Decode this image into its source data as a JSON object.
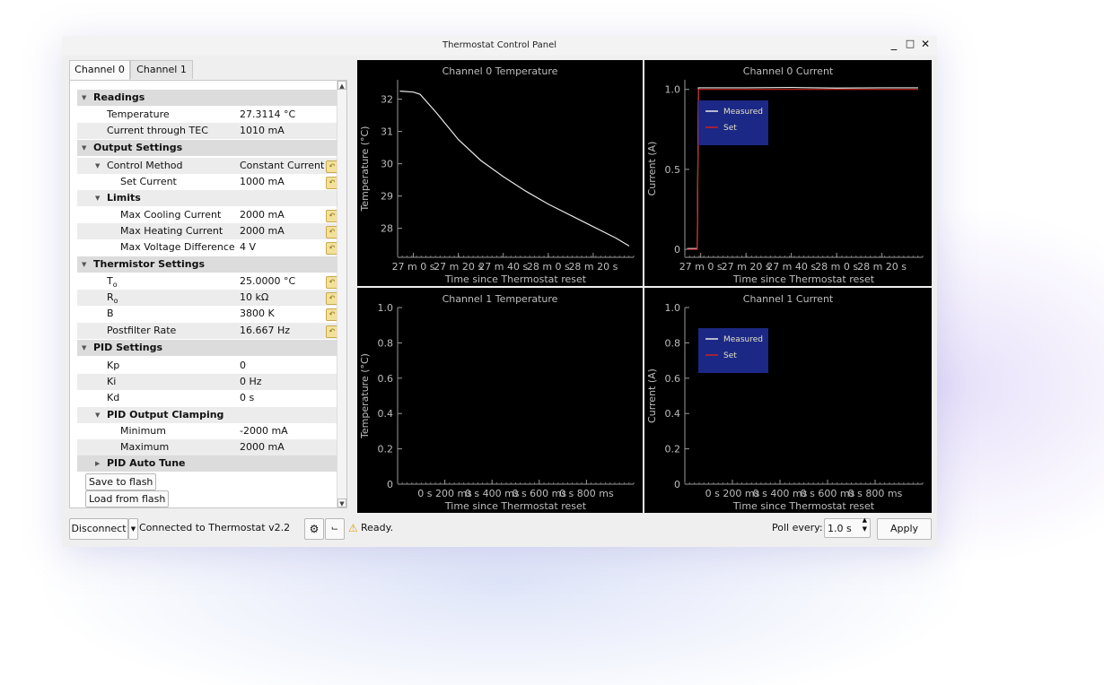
{
  "window": {
    "title": "Thermostat Control Panel",
    "minimize": "_",
    "maximize": "□",
    "close": "✕"
  },
  "tabs": [
    "Channel 0",
    "Channel 1"
  ],
  "tree": {
    "readings": "Readings",
    "temperature_label": "Temperature",
    "temperature_value": "27.3114 °C",
    "current_label": "Current through TEC",
    "current_value": "1010 mA",
    "output_settings": "Output Settings",
    "control_method_label": "Control Method",
    "control_method_value": "Constant Current",
    "set_current_label": "Set Current",
    "set_current_value": "1000 mA",
    "limits": "Limits",
    "max_cooling_label": "Max Cooling Current",
    "max_cooling_value": "2000 mA",
    "max_heating_label": "Max Heating Current",
    "max_heating_value": "2000 mA",
    "max_voltage_label": "Max Voltage Difference",
    "max_voltage_value": "4 V",
    "thermistor_settings": "Thermistor Settings",
    "t0_label": "T",
    "t0_sub": "o",
    "t0_value": "25.0000 °C",
    "r0_label": "R",
    "r0_sub": "o",
    "r0_value": "10 kΩ",
    "b_label": "B",
    "b_value": "3800 K",
    "postfilter_label": "Postfilter Rate",
    "postfilter_value": "16.667 Hz",
    "pid_settings": "PID Settings",
    "kp_label": "Kp",
    "kp_value": "0",
    "ki_label": "Ki",
    "ki_value": "0 Hz",
    "kd_label": "Kd",
    "kd_value": "0 s",
    "pid_clamp": "PID Output Clamping",
    "min_label": "Minimum",
    "min_value": "-2000 mA",
    "max_label": "Maximum",
    "max_value": "2000 mA",
    "autotune": "PID Auto Tune",
    "save": "Save to flash",
    "load": "Load from flash"
  },
  "statusbar": {
    "disconnect": "Disconnect",
    "connection": "Connected to Thermostat v2.2",
    "status": "Ready.",
    "poll_label": "Poll every:",
    "poll_value": "1.0 s",
    "apply": "Apply"
  },
  "chart_data": [
    {
      "type": "line",
      "title": "Channel 0 Temperature",
      "xlabel": "Time since Thermostat reset",
      "ylabel": "Temperature (°C)",
      "x_tick_labels": [
        "27 m 0 s",
        "27 m 20 s",
        "27 m 40 s",
        "28 m 0 s",
        "28 m 20 s"
      ],
      "x_ticks_s": [
        1620,
        1640,
        1660,
        1680,
        1700
      ],
      "xlim_s": [
        1613,
        1718
      ],
      "y_ticks": [
        28,
        29,
        30,
        31,
        32
      ],
      "ylim": [
        27.1,
        32.6
      ],
      "grid": false,
      "series": [
        {
          "color": "#e8e8e8",
          "x_s": [
            1614,
            1620,
            1623,
            1630,
            1640,
            1650,
            1660,
            1670,
            1680,
            1690,
            1700,
            1710,
            1716
          ],
          "values": [
            32.25,
            32.22,
            32.15,
            31.6,
            30.75,
            30.1,
            29.6,
            29.15,
            28.75,
            28.4,
            28.05,
            27.7,
            27.45
          ]
        }
      ]
    },
    {
      "type": "line",
      "title": "Channel 0 Current",
      "xlabel": "Time since Thermostat reset",
      "ylabel": "Current (A)",
      "x_tick_labels": [
        "27 m 0 s",
        "27 m 20 s",
        "27 m 40 s",
        "28 m 0 s",
        "28 m 20 s"
      ],
      "x_ticks_s": [
        1620,
        1640,
        1660,
        1680,
        1700
      ],
      "xlim_s": [
        1613,
        1718
      ],
      "y_ticks": [
        0,
        0.5,
        1.0
      ],
      "y_tick_labels": [
        "0",
        "0.5",
        "1.0"
      ],
      "ylim": [
        -0.05,
        1.06
      ],
      "grid": false,
      "legend": "top-left",
      "series": [
        {
          "name": "Measured",
          "color": "#e8e8e8",
          "x_s": [
            1614,
            1618.5,
            1619,
            1640,
            1660,
            1680,
            1700,
            1716
          ],
          "values": [
            0.005,
            0.005,
            1.01,
            1.01,
            1.012,
            1.008,
            1.01,
            1.01
          ]
        },
        {
          "name": "Set",
          "color": "#cc2020",
          "x_s": [
            1614,
            1618.5,
            1619,
            1716
          ],
          "values": [
            0.0,
            0.0,
            1.0,
            1.0
          ]
        }
      ]
    },
    {
      "type": "line",
      "title": "Channel 1 Temperature",
      "xlabel": "Time since Thermostat reset",
      "ylabel": "Temperature (°C)",
      "x_tick_labels": [
        "0 s 200 ms",
        "0 s 400 ms",
        "0 s 600 ms",
        "0 s 800 ms"
      ],
      "x_ticks_s": [
        0.2,
        0.4,
        0.6,
        0.8
      ],
      "xlim_s": [
        0,
        1
      ],
      "y_ticks": [
        0,
        0.2,
        0.4,
        0.6,
        0.8,
        1.0
      ],
      "y_tick_labels": [
        "0",
        "0.2",
        "0.4",
        "0.6",
        "0.8",
        "1.0"
      ],
      "ylim": [
        0,
        1
      ],
      "grid": false,
      "series": []
    },
    {
      "type": "line",
      "title": "Channel 1 Current",
      "xlabel": "Time since Thermostat reset",
      "ylabel": "Current (A)",
      "x_tick_labels": [
        "0 s 200 ms",
        "0 s 400 ms",
        "0 s 600 ms",
        "0 s 800 ms"
      ],
      "x_ticks_s": [
        0.2,
        0.4,
        0.6,
        0.8
      ],
      "xlim_s": [
        0,
        1
      ],
      "y_ticks": [
        0,
        0.2,
        0.4,
        0.6,
        0.8,
        1.0
      ],
      "y_tick_labels": [
        "0",
        "0.2",
        "0.4",
        "0.6",
        "0.8",
        "1.0"
      ],
      "ylim": [
        0,
        1
      ],
      "grid": false,
      "legend": "top-left",
      "series": [
        {
          "name": "Measured",
          "color": "#e8e8e8",
          "x_s": [],
          "values": []
        },
        {
          "name": "Set",
          "color": "#cc2020",
          "x_s": [],
          "values": []
        }
      ]
    }
  ]
}
